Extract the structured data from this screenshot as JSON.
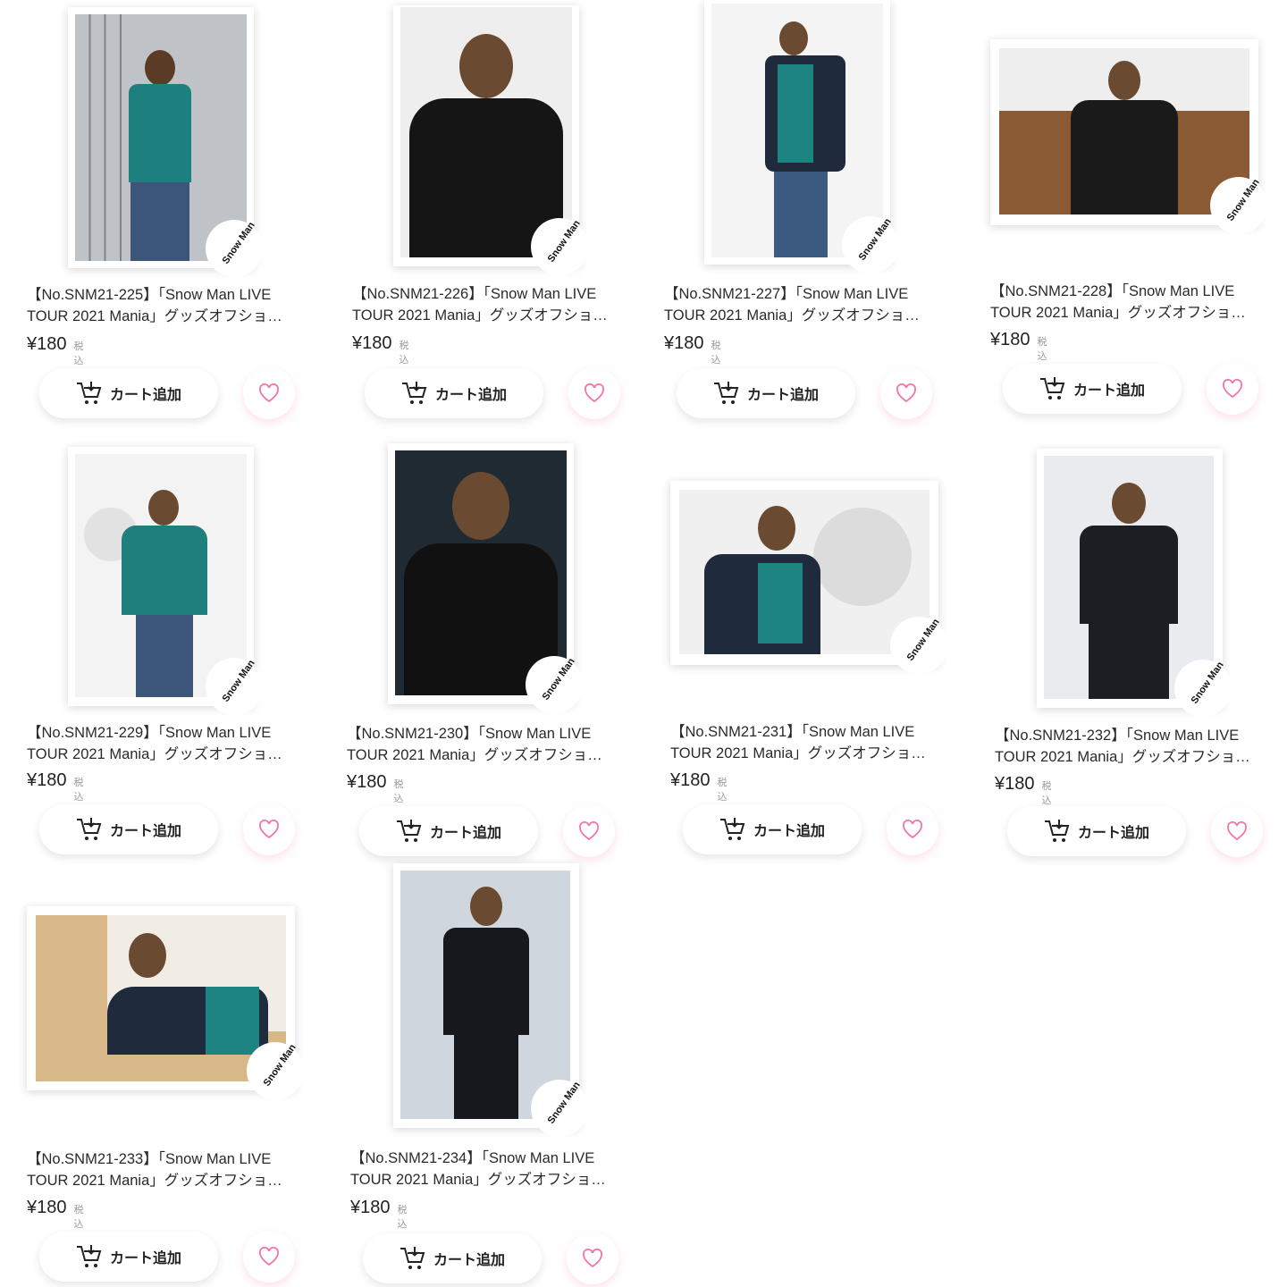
{
  "products": [
    {
      "title_line1": "【No.SNM21-225】「Snow Man LIVE",
      "title_line2": "TOUR 2021 Mania」グッズオフショ…",
      "price": "¥180",
      "tax_label": "税込",
      "cart_label": "カート追加",
      "logo_text": "Snow Man"
    },
    {
      "title_line1": "【No.SNM21-226】「Snow Man LIVE",
      "title_line2": "TOUR 2021 Mania」グッズオフショ…",
      "price": "¥180",
      "tax_label": "税込",
      "cart_label": "カート追加",
      "logo_text": "Snow Man"
    },
    {
      "title_line1": "【No.SNM21-227】「Snow Man LIVE",
      "title_line2": "TOUR 2021 Mania」グッズオフショ…",
      "price": "¥180",
      "tax_label": "税込",
      "cart_label": "カート追加",
      "logo_text": "Snow Man"
    },
    {
      "title_line1": "【No.SNM21-228】「Snow Man LIVE",
      "title_line2": "TOUR 2021 Mania」グッズオフショ…",
      "price": "¥180",
      "tax_label": "税込",
      "cart_label": "カート追加",
      "logo_text": "Snow Man"
    },
    {
      "title_line1": "【No.SNM21-229】「Snow Man LIVE",
      "title_line2": "TOUR 2021 Mania」グッズオフショ…",
      "price": "¥180",
      "tax_label": "税込",
      "cart_label": "カート追加",
      "logo_text": "Snow Man"
    },
    {
      "title_line1": "【No.SNM21-230】「Snow Man LIVE",
      "title_line2": "TOUR 2021 Mania」グッズオフショ…",
      "price": "¥180",
      "tax_label": "税込",
      "cart_label": "カート追加",
      "logo_text": "Snow Man"
    },
    {
      "title_line1": "【No.SNM21-231】「Snow Man LIVE",
      "title_line2": "TOUR 2021 Mania」グッズオフショ…",
      "price": "¥180",
      "tax_label": "税込",
      "cart_label": "カート追加",
      "logo_text": "Snow Man"
    },
    {
      "title_line1": "【No.SNM21-232】「Snow Man LIVE",
      "title_line2": "TOUR 2021 Mania」グッズオフショ…",
      "price": "¥180",
      "tax_label": "税込",
      "cart_label": "カート追加",
      "logo_text": "Snow Man"
    },
    {
      "title_line1": "【No.SNM21-233】「Snow Man LIVE",
      "title_line2": "TOUR 2021 Mania」グッズオフショ…",
      "price": "¥180",
      "tax_label": "税込",
      "cart_label": "カート追加",
      "logo_text": "Snow Man"
    },
    {
      "title_line1": "【No.SNM21-234】「Snow Man LIVE",
      "title_line2": "TOUR 2021 Mania」グッズオフショ…",
      "price": "¥180",
      "tax_label": "税込",
      "cart_label": "カート追加",
      "logo_text": "Snow Man"
    }
  ],
  "icons": {
    "cart": "cart-add-icon",
    "favorite": "heart-outline-icon"
  },
  "colors": {
    "heart": "#f075a8",
    "text": "#222222",
    "tax": "#9a9a9a"
  }
}
